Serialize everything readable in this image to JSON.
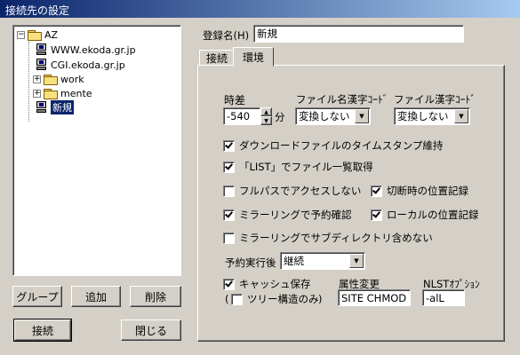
{
  "window": {
    "title": "接続先の設定"
  },
  "tree": {
    "root": "AZ",
    "items": [
      {
        "label": "WWW.ekoda.gr.jp"
      },
      {
        "label": "CGI.ekoda.gr.jp"
      },
      {
        "label": "work"
      },
      {
        "label": "mente"
      },
      {
        "label": "新規"
      }
    ],
    "expand_minus": "−",
    "expand_plus": "+"
  },
  "left_buttons": {
    "group": "グループ",
    "add": "追加",
    "delete": "削除",
    "connect": "接続",
    "close": "閉じる"
  },
  "register": {
    "label": "登録名(H)",
    "value": "新規"
  },
  "tabs": [
    "接続",
    "環境"
  ],
  "env": {
    "time_diff_label": "時差",
    "time_diff_value": "-540",
    "minutes_unit": "分",
    "filename_kanji_label": "ファイル名漢字ｺｰﾄﾞ",
    "filename_kanji_value": "変換しない",
    "file_kanji_label": "ファイル漢字ｺｰﾄﾞ",
    "file_kanji_value": "変換しない",
    "keep_timestamp": "ダウンロードファイルのタイムスタンプ維持",
    "list_command": "「LIST」でファイル一覧取得",
    "no_fullpath": "フルパスでアクセスしない",
    "record_disconnect_pos": "切断時の位置記録",
    "mirror_confirm": "ミラーリングで予約確認",
    "record_local_pos": "ローカルの位置記録",
    "mirror_no_subdir": "ミラーリングでサブディレクトリ含めない",
    "after_reserve_label": "予約実行後",
    "after_reserve_value": "継続",
    "cache_save": "キャッシュ保存",
    "paren_open": "(",
    "tree_only": "ツリー構造のみ",
    "paren_close": ")",
    "attr_change_label": "属性変更",
    "attr_change_value": "SITE CHMOD",
    "nlst_label": "NLSTｵﾌﾟｼｮﾝ",
    "nlst_value": "-alL"
  },
  "checks": {
    "keep_timestamp": true,
    "list_command": true,
    "no_fullpath": false,
    "record_disconnect_pos": true,
    "mirror_confirm": true,
    "record_local_pos": true,
    "mirror_no_subdir": false,
    "cache_save": true,
    "tree_only": false
  }
}
